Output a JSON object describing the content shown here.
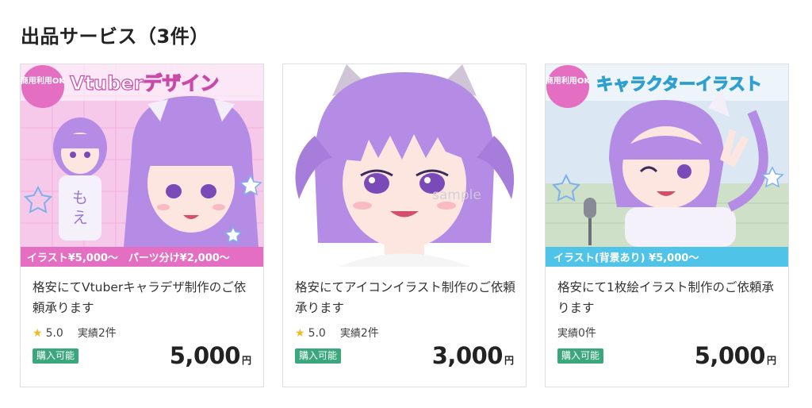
{
  "section": {
    "title": "出品サービス（3件）"
  },
  "cards": [
    {
      "title": "格安にてVtuberキャラデザ制作のご依頼承ります",
      "rating": "5.0",
      "jisseki_label": "実績",
      "jisseki_count": "2件",
      "status": "購入可能",
      "price": "5,000",
      "currency": "円",
      "thumb": {
        "corner": "商用利用OK",
        "headline": "Vtuberデザイン",
        "footer": "イラスト¥5,000〜　パーツ分け¥2,000〜",
        "bg": "#f6c9ea",
        "banner": "#e46fc2"
      }
    },
    {
      "title": "格安にてアイコンイラスト制作のご依頼承ります",
      "rating": "5.0",
      "jisseki_label": "実績",
      "jisseki_count": "2件",
      "status": "購入可能",
      "price": "3,000",
      "currency": "円",
      "thumb": {
        "watermark": "sample",
        "bg": "#ffffff"
      }
    },
    {
      "title": "格安にて1枚絵イラスト制作のご依頼承ります",
      "rating": null,
      "jisseki_label": "実績",
      "jisseki_count": "0件",
      "status": "購入可能",
      "price": "5,000",
      "currency": "円",
      "thumb": {
        "corner": "商用利用OK",
        "headline": "キャラクターイラスト",
        "footer": "イラスト(背景あり) ¥5,000〜",
        "bg": "#dbe8f4",
        "banner": "#4fc3e8"
      }
    }
  ],
  "icons": {
    "star": "star-icon"
  },
  "colors": {
    "accent_green": "#3aa77d",
    "star": "#f5b921",
    "hair": "#b48ce6"
  }
}
